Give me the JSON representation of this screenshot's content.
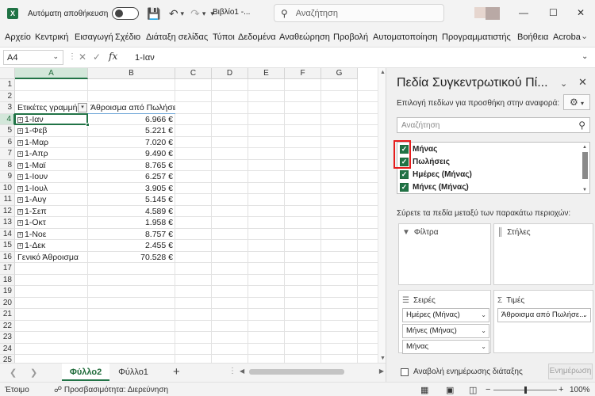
{
  "titlebar": {
    "autosave_label": "Αυτόματη αποθήκευση",
    "doc_title": "Βιβλίο1 -...",
    "search_placeholder": "Αναζήτηση",
    "excel_glyph": "X"
  },
  "ribbon": {
    "tabs": [
      "Αρχείο",
      "Κεντρική",
      "Εισαγωγή",
      "Σχέδιο",
      "Διάταξη σελίδας",
      "Τύποι",
      "Δεδομένα",
      "Αναθεώρηση",
      "Προβολή",
      "Αυτοματοποίηση",
      "Προγραμματιστής",
      "Βοήθεια",
      "Acroba"
    ]
  },
  "formula_bar": {
    "name_box": "A4",
    "fx_label": "fx",
    "value": "1-Ιαν"
  },
  "grid": {
    "columns": [
      "A",
      "B",
      "C",
      "D",
      "E",
      "F",
      "G"
    ],
    "selected_column": "A",
    "rows": [
      "1",
      "2",
      "3",
      "4",
      "5",
      "6",
      "7",
      "8",
      "9",
      "10",
      "11",
      "12",
      "13",
      "14",
      "15",
      "16",
      "17",
      "18",
      "19",
      "20",
      "21",
      "22",
      "23",
      "24",
      "25"
    ],
    "selected_row": "4",
    "pivot_header": {
      "row_labels": "Ετικέτες γραμμής",
      "values": "Άθροισμα από Πωλήσεις"
    },
    "pivot_rows": [
      {
        "label": "1-Ιαν",
        "value": "6.966 €"
      },
      {
        "label": "1-Φεβ",
        "value": "5.221 €"
      },
      {
        "label": "1-Μαρ",
        "value": "7.020 €"
      },
      {
        "label": "1-Απρ",
        "value": "9.490 €"
      },
      {
        "label": "1-Μαϊ",
        "value": "8.765 €"
      },
      {
        "label": "1-Ιουν",
        "value": "6.257 €"
      },
      {
        "label": "1-Ιουλ",
        "value": "3.905 €"
      },
      {
        "label": "1-Αυγ",
        "value": "5.145 €"
      },
      {
        "label": "1-Σεπ",
        "value": "4.589 €"
      },
      {
        "label": "1-Οκτ",
        "value": "1.958 €"
      },
      {
        "label": "1-Νοε",
        "value": "8.757 €"
      },
      {
        "label": "1-Δεκ",
        "value": "2.455 €"
      }
    ],
    "grand_total": {
      "label": "Γενικό Άθροισμα",
      "value": "70.528 €"
    },
    "expand_glyph": "+"
  },
  "sheets": {
    "tabs": [
      "Φύλλο2",
      "Φύλλο1"
    ],
    "active": "Φύλλο2"
  },
  "status": {
    "ready": "Έτοιμο",
    "accessibility": "Προσβασιμότητα: Διερεύνηση",
    "zoom": "100%"
  },
  "pivot_pane": {
    "title": "Πεδία Συγκεντρωτικού Πί...",
    "subtitle": "Επιλογή πεδίων για προσθήκη στην αναφορά:",
    "search_placeholder": "Αναζήτηση",
    "fields": [
      {
        "label": "Μήνας",
        "checked": true
      },
      {
        "label": "Πωλήσεις",
        "checked": true
      },
      {
        "label": "Ημέρες (Μήνας)",
        "checked": true
      },
      {
        "label": "Μήνες (Μήνας)",
        "checked": true
      }
    ],
    "drag_hint": "Σύρετε τα πεδία μεταξύ των παρακάτω περιοχών:",
    "areas": {
      "filters": {
        "label": "Φίλτρα",
        "items": []
      },
      "columns": {
        "label": "Στήλες",
        "items": []
      },
      "rows": {
        "label": "Σειρές",
        "items": [
          "Ημέρες (Μήνας)",
          "Μήνες (Μήνας)",
          "Μήνας"
        ]
      },
      "values": {
        "label": "Τιμές",
        "items": [
          "Άθροισμα από Πωλήσε..."
        ]
      }
    },
    "defer_label": "Αναβολή ενημέρωσης διάταξης",
    "update_button": "Ενημέρωση"
  }
}
